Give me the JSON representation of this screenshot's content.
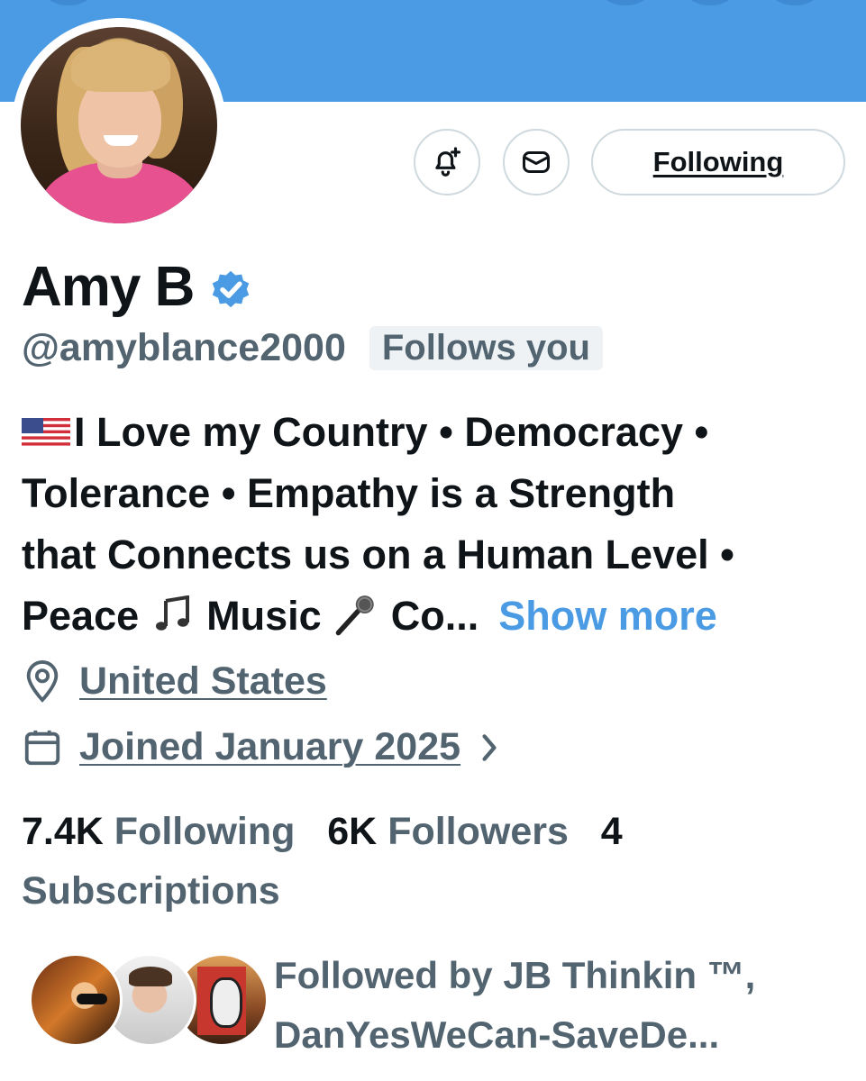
{
  "header": {
    "banner_color": "#4a9be3"
  },
  "profile": {
    "name": "Amy B",
    "handle": "@amyblance2000",
    "follows_you_badge": "Follows you",
    "verified_icon": "verified-badge-icon",
    "bio": {
      "line1": "I Love my Country • Democracy •",
      "line2": "Tolerance • Empathy is a Strength",
      "line3": "that Connects us on a Human Level •",
      "line4_a": "Peace",
      "line4_b": "Music",
      "line4_c": "Co...",
      "show_more": "Show more"
    },
    "location": "United States",
    "joined": "Joined January 2025"
  },
  "actions": {
    "notify_icon": "bell-plus-icon",
    "message_icon": "envelope-icon",
    "follow_label": "Following"
  },
  "stats": {
    "following_count": "7.4K",
    "following_label": "Following",
    "followers_count": "6K",
    "followers_label": "Followers",
    "subscriptions_count": "4",
    "subscriptions_label": "Subscriptions"
  },
  "followed_by": {
    "line1": "Followed by JB Thinkin ™,",
    "line2": "DanYesWeCan-SaveDe..."
  },
  "colors": {
    "accent": "#4a9be3",
    "muted": "#536471",
    "text": "#0f1419"
  }
}
